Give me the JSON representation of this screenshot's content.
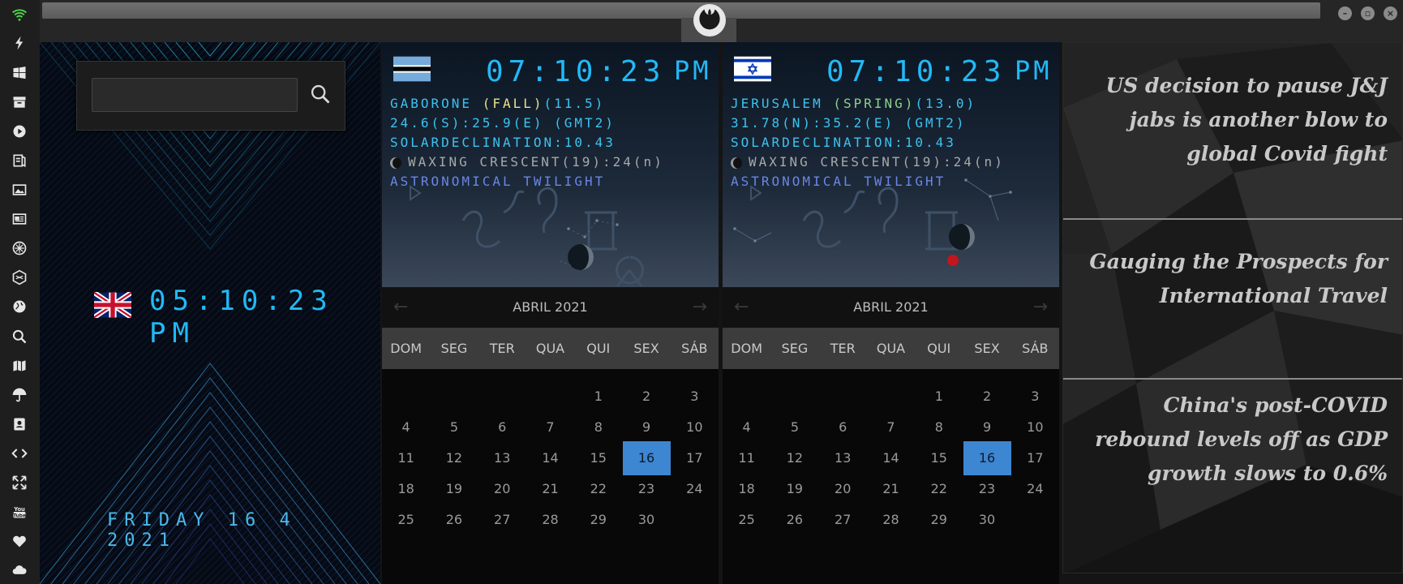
{
  "search": {
    "placeholder": "",
    "value": ""
  },
  "local": {
    "time": "05:10:23 PM",
    "date": "FRIDAY 16 4 2021"
  },
  "cities": [
    {
      "time": "07:10:23",
      "ampm": "PM",
      "line1_city": "GABORONE ",
      "line1_season": "(FALL)",
      "line1_temp": "(11.5)",
      "coords": "24.6(S):25.9(E) (GMT2)",
      "solar": "SOLARDECLINATION:10.43",
      "moon": "WAXING CRESCENT(19):24(n)",
      "twilight": "ASTRONOMICAL TWILIGHT",
      "calendar": {
        "month": "ABRIL 2021",
        "prev": "←",
        "next": "→",
        "weekdays": [
          "DOM",
          "SEG",
          "TER",
          "QUA",
          "QUI",
          "SEX",
          "SÁB"
        ],
        "first_weekday": 4,
        "days": [
          "1",
          "2",
          "3",
          "4",
          "5",
          "6",
          "7",
          "8",
          "9",
          "10",
          "11",
          "12",
          "13",
          "14",
          "15",
          "16",
          "17",
          "18",
          "19",
          "20",
          "21",
          "22",
          "23",
          "24",
          "25",
          "26",
          "27",
          "28",
          "29",
          "30"
        ],
        "today": "16"
      }
    },
    {
      "time": "07:10:23",
      "ampm": "PM",
      "line1_city": "JERUSALEM ",
      "line1_season": "(SPRING)",
      "line1_temp": "(13.0)",
      "coords": "31.78(N):35.2(E) (GMT2)",
      "solar": "SOLARDECLINATION:10.43",
      "moon": "WAXING CRESCENT(19):24(n)",
      "twilight": "ASTRONOMICAL TWILIGHT",
      "calendar": {
        "month": "ABRIL 2021",
        "prev": "←",
        "next": "→",
        "weekdays": [
          "DOM",
          "SEG",
          "TER",
          "QUA",
          "QUI",
          "SEX",
          "SÁB"
        ],
        "first_weekday": 4,
        "days": [
          "1",
          "2",
          "3",
          "4",
          "5",
          "6",
          "7",
          "8",
          "9",
          "10",
          "11",
          "12",
          "13",
          "14",
          "15",
          "16",
          "17",
          "18",
          "19",
          "20",
          "21",
          "22",
          "23",
          "24",
          "25",
          "26",
          "27",
          "28",
          "29",
          "30"
        ],
        "today": "16"
      }
    }
  ],
  "news": [
    "US decision to pause J&J jabs is another blow to global Covid fight",
    "Gauging the Prospects for International Travel",
    "China's post-COVID rebound levels off as GDP growth slows to 0.6%"
  ],
  "icons": [
    "wifi-icon",
    "lightning-icon",
    "windows-icon",
    "archive-icon",
    "play-icon",
    "map-book-icon",
    "image-icon",
    "newspaper-icon",
    "star-icon",
    "hexagon-icon",
    "globe-icon",
    "search-icon",
    "map-icon",
    "umbrella-icon",
    "contacts-icon",
    "code-icon",
    "expand-icon",
    "youtube-icon",
    "heart-icon",
    "cloud-icon"
  ],
  "colors": {
    "digital": "#22b9f6",
    "today": "#3d86d1",
    "season": "#e6e28c",
    "twilight": "#6a86e6"
  }
}
